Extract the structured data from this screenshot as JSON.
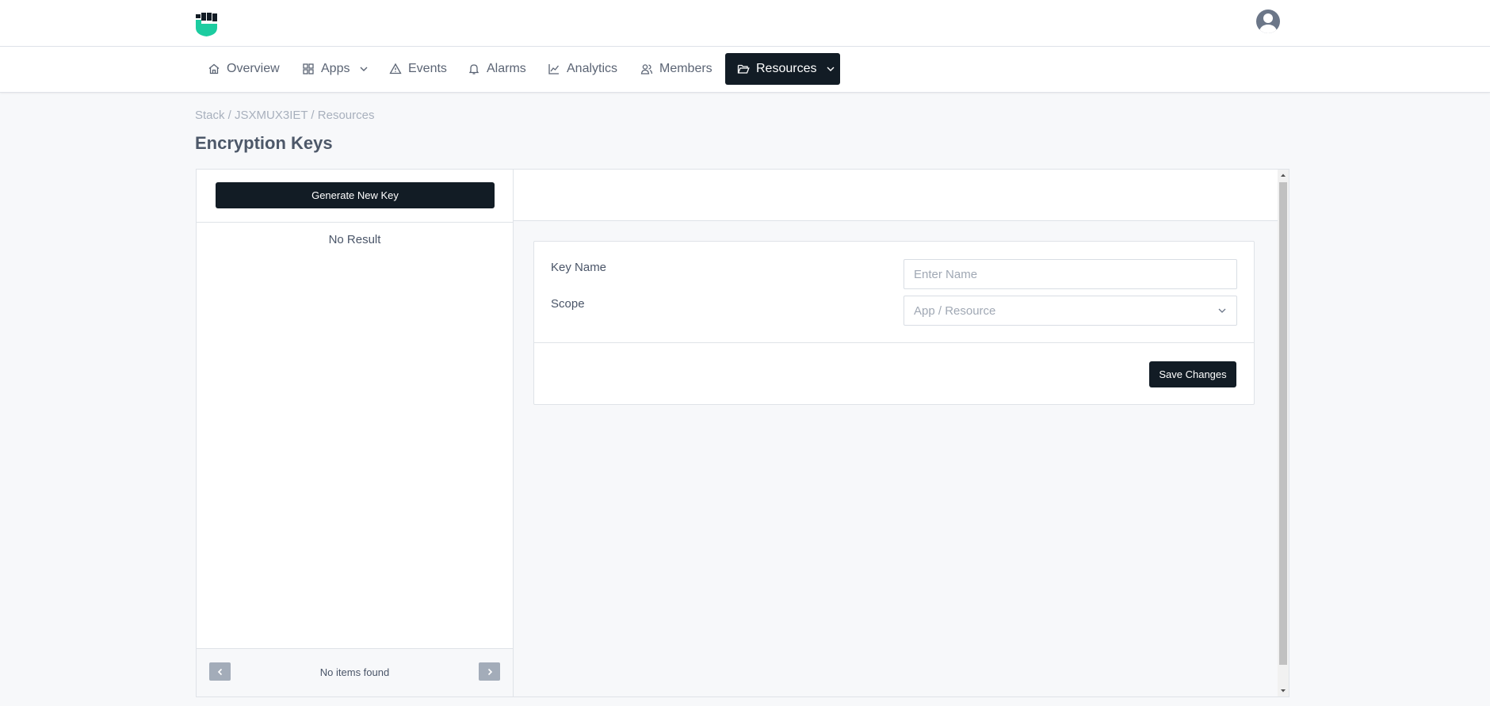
{
  "header": {
    "logo_icon": "fist-shield-logo",
    "avatar_icon": "user-avatar-icon",
    "brand_color": "#1ccca0"
  },
  "nav": {
    "items": [
      {
        "label": "Overview",
        "icon": "home-icon"
      },
      {
        "label": "Apps",
        "icon": "grid-icon",
        "dropdown": true
      },
      {
        "label": "Events",
        "icon": "warning-triangle-icon"
      },
      {
        "label": "Alarms",
        "icon": "bell-icon"
      },
      {
        "label": "Analytics",
        "icon": "chart-line-icon"
      },
      {
        "label": "Members",
        "icon": "users-icon"
      },
      {
        "label": "Resources",
        "icon": "folder-open-icon",
        "dropdown": true,
        "active": true
      }
    ],
    "active_color": "#121c25"
  },
  "breadcrumb": {
    "text": "Stack / JSXMUX3IET / Resources"
  },
  "page": {
    "title": "Encryption Keys"
  },
  "key_list": {
    "generate_label": "Generate New Key",
    "empty_text": "No Result",
    "footer_text": "No items found"
  },
  "form": {
    "key_name_label": "Key Name",
    "key_name_placeholder": "Enter Name",
    "key_name_value": "",
    "scope_label": "Scope",
    "scope_placeholder": "App / Resource",
    "save_label": "Save Changes"
  }
}
